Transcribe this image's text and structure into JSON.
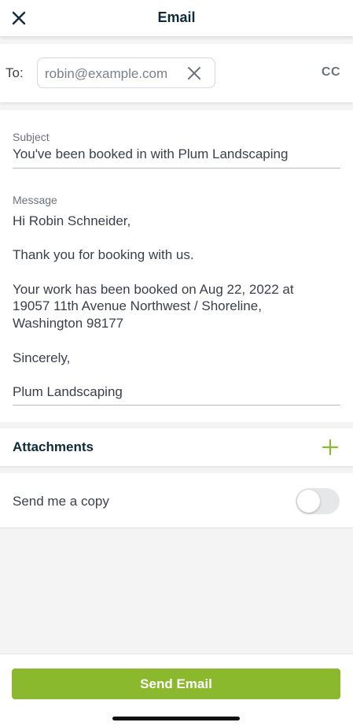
{
  "header": {
    "title": "Email",
    "close_icon": "close-icon"
  },
  "recipients": {
    "to_label": "To:",
    "chips": [
      {
        "email": "robin@example.com",
        "remove_icon": "close-icon"
      }
    ],
    "cc_label": "CC"
  },
  "subject": {
    "label": "Subject",
    "value": "You've been booked in with Plum Landscaping"
  },
  "message": {
    "label": "Message",
    "paragraphs": [
      "Hi Robin Schneider,",
      "Thank you for booking with us.",
      "Your work has been booked on Aug 22, 2022 at\n19057 11th Avenue Northwest / Shoreline,\nWashington  98177",
      "Sincerely,",
      "Plum Landscaping"
    ]
  },
  "attachments": {
    "title": "Attachments",
    "add_icon": "plus-icon"
  },
  "send_copy": {
    "label": "Send me a copy",
    "enabled": false
  },
  "footer": {
    "send_label": "Send Email"
  },
  "colors": {
    "accent": "#8bb92d",
    "title": "#0f2b3a",
    "text": "#3b4048",
    "muted": "#6d7379",
    "background": "#f4f4f5"
  }
}
